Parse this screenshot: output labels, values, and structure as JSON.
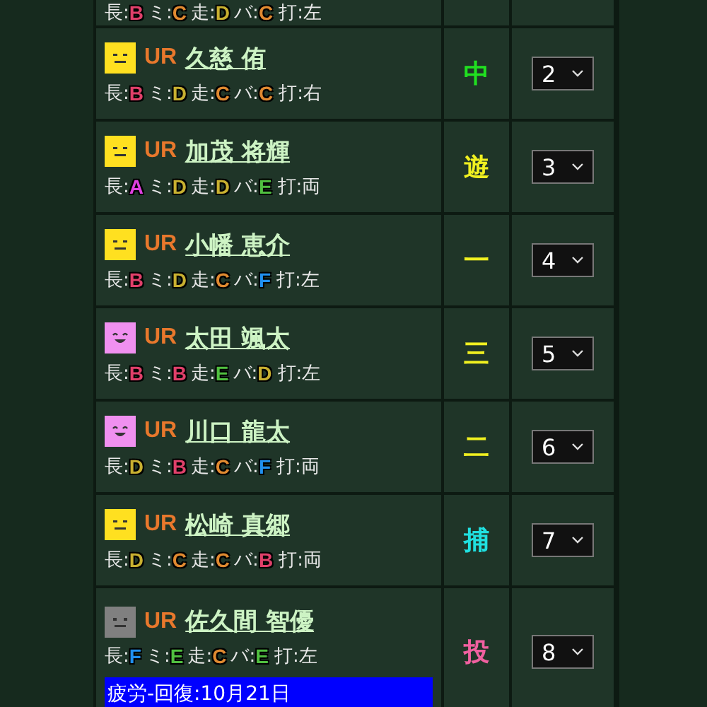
{
  "players": [
    {
      "stats": [
        {
          "label": "長:",
          "grade": "B",
          "color": "#e0406a"
        },
        {
          "label": "ミ:",
          "grade": "C",
          "color": "#e08a30"
        },
        {
          "label": "走:",
          "grade": "D",
          "color": "#c8b030"
        },
        {
          "label": "バ:",
          "grade": "C",
          "color": "#e08a30"
        }
      ],
      "hand": "打:左"
    },
    {
      "face": {
        "kind": "neutral",
        "color": "#ffe020"
      },
      "rarity": "UR",
      "name": "久慈 侑",
      "stats": [
        {
          "label": "長:",
          "grade": "B",
          "color": "#e0406a"
        },
        {
          "label": "ミ:",
          "grade": "D",
          "color": "#c8b030"
        },
        {
          "label": "走:",
          "grade": "C",
          "color": "#e08a30"
        },
        {
          "label": "バ:",
          "grade": "C",
          "color": "#e08a30"
        }
      ],
      "hand": "打:右",
      "position": {
        "text": "中",
        "color": "#20e020"
      },
      "order": "2"
    },
    {
      "face": {
        "kind": "neutral",
        "color": "#ffe020"
      },
      "rarity": "UR",
      "name": "加茂 将輝",
      "stats": [
        {
          "label": "長:",
          "grade": "A",
          "color": "#e040e0"
        },
        {
          "label": "ミ:",
          "grade": "D",
          "color": "#c8b030"
        },
        {
          "label": "走:",
          "grade": "D",
          "color": "#c8b030"
        },
        {
          "label": "バ:",
          "grade": "E",
          "color": "#50c040"
        }
      ],
      "hand": "打:両",
      "position": {
        "text": "遊",
        "color": "#f0f020"
      },
      "order": "3"
    },
    {
      "face": {
        "kind": "neutral",
        "color": "#ffe020"
      },
      "rarity": "UR",
      "name": "小幡 恵介",
      "stats": [
        {
          "label": "長:",
          "grade": "B",
          "color": "#e0406a"
        },
        {
          "label": "ミ:",
          "grade": "D",
          "color": "#c8b030"
        },
        {
          "label": "走:",
          "grade": "C",
          "color": "#e08a30"
        },
        {
          "label": "バ:",
          "grade": "F",
          "color": "#2090f0"
        }
      ],
      "hand": "打:左",
      "position": {
        "text": "一",
        "color": "#f0f020"
      },
      "order": "4"
    },
    {
      "face": {
        "kind": "smile",
        "color": "#f090f0"
      },
      "rarity": "UR",
      "name": "太田 颯太",
      "stats": [
        {
          "label": "長:",
          "grade": "B",
          "color": "#e0406a"
        },
        {
          "label": "ミ:",
          "grade": "B",
          "color": "#e0406a"
        },
        {
          "label": "走:",
          "grade": "E",
          "color": "#50c040"
        },
        {
          "label": "バ:",
          "grade": "D",
          "color": "#c8b030"
        }
      ],
      "hand": "打:左",
      "position": {
        "text": "三",
        "color": "#f0f020"
      },
      "order": "5"
    },
    {
      "face": {
        "kind": "smile",
        "color": "#f090f0"
      },
      "rarity": "UR",
      "name": "川口 龍太",
      "stats": [
        {
          "label": "長:",
          "grade": "D",
          "color": "#c8b030"
        },
        {
          "label": "ミ:",
          "grade": "B",
          "color": "#e0406a"
        },
        {
          "label": "走:",
          "grade": "C",
          "color": "#e08a30"
        },
        {
          "label": "バ:",
          "grade": "F",
          "color": "#2090f0"
        }
      ],
      "hand": "打:両",
      "position": {
        "text": "二",
        "color": "#f0f020"
      },
      "order": "6"
    },
    {
      "face": {
        "kind": "neutral",
        "color": "#ffe020"
      },
      "rarity": "UR",
      "name": "松崎 真郷",
      "stats": [
        {
          "label": "長:",
          "grade": "D",
          "color": "#c8b030"
        },
        {
          "label": "ミ:",
          "grade": "C",
          "color": "#e08a30"
        },
        {
          "label": "走:",
          "grade": "C",
          "color": "#e08a30"
        },
        {
          "label": "バ:",
          "grade": "B",
          "color": "#e0406a"
        }
      ],
      "hand": "打:両",
      "position": {
        "text": "捕",
        "color": "#20e0e0"
      },
      "order": "7"
    },
    {
      "face": {
        "kind": "flat",
        "color": "#808080"
      },
      "rarity": "UR",
      "name": "佐久間 智優",
      "stats": [
        {
          "label": "長:",
          "grade": "F",
          "color": "#2090f0"
        },
        {
          "label": "ミ:",
          "grade": "E",
          "color": "#50c040"
        },
        {
          "label": "走:",
          "grade": "C",
          "color": "#e08a30"
        },
        {
          "label": "バ:",
          "grade": "E",
          "color": "#50c040"
        }
      ],
      "hand": "打:左",
      "position": {
        "text": "投",
        "color": "#f060a0"
      },
      "order": "8",
      "fatigue": "疲労-回復:10月21日"
    }
  ]
}
